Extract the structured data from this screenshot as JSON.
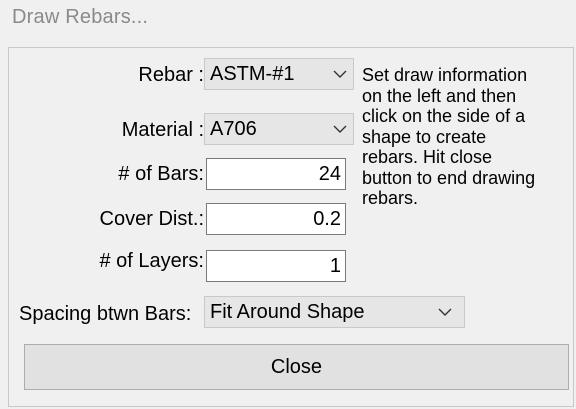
{
  "window": {
    "title": "Draw Rebars..."
  },
  "form": {
    "rebar": {
      "label": "Rebar :",
      "value": "ASTM-#1"
    },
    "material": {
      "label": "Material :",
      "value": "A706"
    },
    "num_bars": {
      "label": "# of Bars:",
      "value": "24"
    },
    "cover_dist": {
      "label": "Cover Dist.:",
      "value": "0.2"
    },
    "num_layers": {
      "label": "# of Layers:",
      "value": "1"
    },
    "spacing": {
      "label": "Spacing btwn Bars:",
      "value": "Fit Around Shape"
    }
  },
  "info": {
    "lines": [
      "Set draw information",
      "on the left and then",
      "click on the side of a",
      "shape to create",
      "rebars. Hit close",
      "button to end drawing",
      "rebars."
    ]
  },
  "buttons": {
    "close_label": "Close"
  },
  "icons": {
    "dropdown": "chevron-down-icon"
  }
}
